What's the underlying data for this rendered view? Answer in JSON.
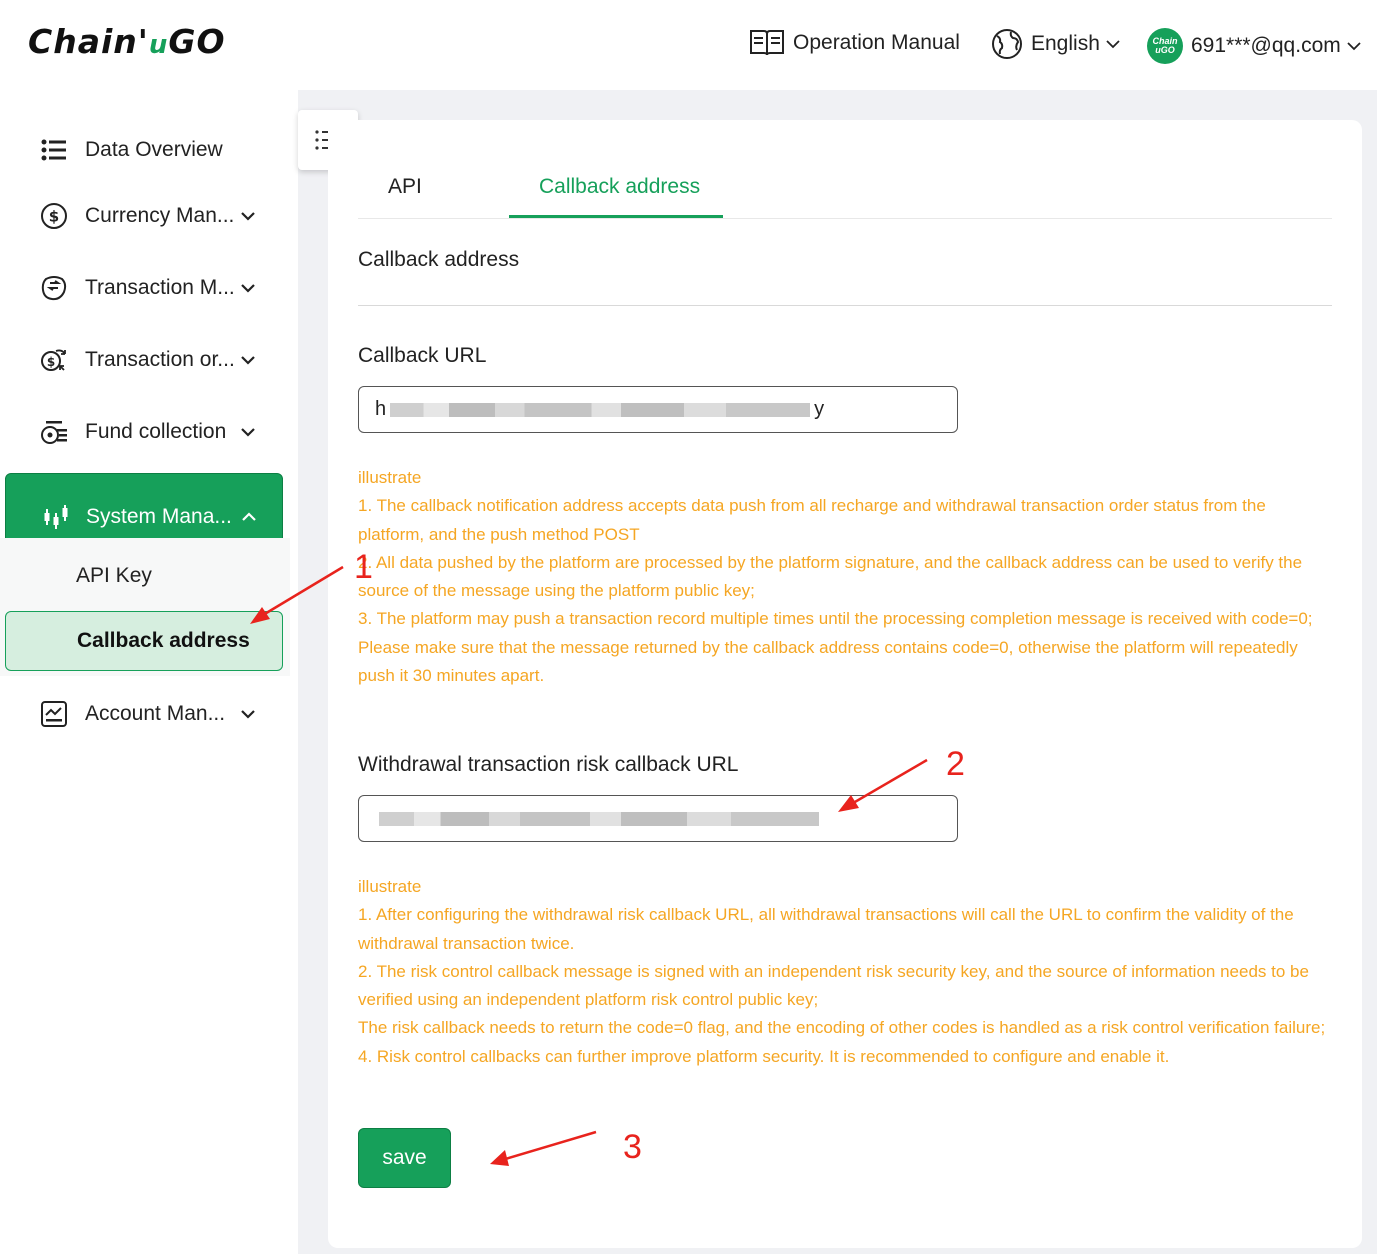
{
  "header": {
    "logo": {
      "part1": "Chain'",
      "part2": "u",
      "part3": "GO"
    },
    "manual_label": "Operation Manual",
    "language": "English",
    "avatar_text": "Chain uGO",
    "user": "691***@qq.com"
  },
  "sidebar": {
    "items": [
      {
        "label": "Data Overview",
        "icon": "list-icon"
      },
      {
        "label": "Currency Man...",
        "icon": "dollar-icon"
      },
      {
        "label": "Transaction M...",
        "icon": "transaction-icon"
      },
      {
        "label": "Transaction or...",
        "icon": "coin-order-icon"
      },
      {
        "label": "Fund collection",
        "icon": "fund-icon"
      },
      {
        "label": "System Mana...",
        "icon": "candlestick-icon"
      },
      {
        "label": "Account Man...",
        "icon": "account-icon"
      }
    ],
    "submenu": [
      {
        "label": "API Key"
      },
      {
        "label": "Callback address"
      }
    ]
  },
  "tabs": [
    {
      "label": "API"
    },
    {
      "label": "Callback address"
    }
  ],
  "section_title": "Callback address",
  "callback_url": {
    "label": "Callback URL",
    "value_start": "h",
    "value_end": "y"
  },
  "illustrate1": {
    "heading": "illustrate",
    "lines": [
      "1. The callback notification address accepts data push from all recharge and withdrawal transaction order status from the platform, and the push method POST",
      "2. All data pushed by the platform are processed by the platform signature, and the callback address can be used to verify the source of the message using the platform public key;",
      "3. The platform may push a transaction record multiple times until the processing completion message is received with code=0;",
      "Please make sure that the message returned by the callback address contains code=0, otherwise the platform will repeatedly push it 30 minutes apart."
    ]
  },
  "risk_url": {
    "label": "Withdrawal transaction risk callback URL",
    "value_start": "",
    "value_end": ""
  },
  "illustrate2": {
    "heading": "illustrate",
    "lines": [
      "1. After configuring the withdrawal risk callback URL, all withdrawal transactions will call the URL to confirm the validity of the withdrawal transaction twice.",
      "2. The risk control callback message is signed with an independent risk security key, and the source of information needs to be verified using an independent platform risk control public key;",
      "The risk callback needs to return the code=0 flag, and the encoding of other codes is handled as a risk control verification failure;",
      "4. Risk control callbacks can further improve platform security. It is recommended to configure and enable it."
    ]
  },
  "save_label": "save",
  "annotations": [
    "1",
    "2",
    "3"
  ],
  "colors": {
    "accent": "#16a05a",
    "note": "#f5a623",
    "annotation": "#e8231d"
  }
}
